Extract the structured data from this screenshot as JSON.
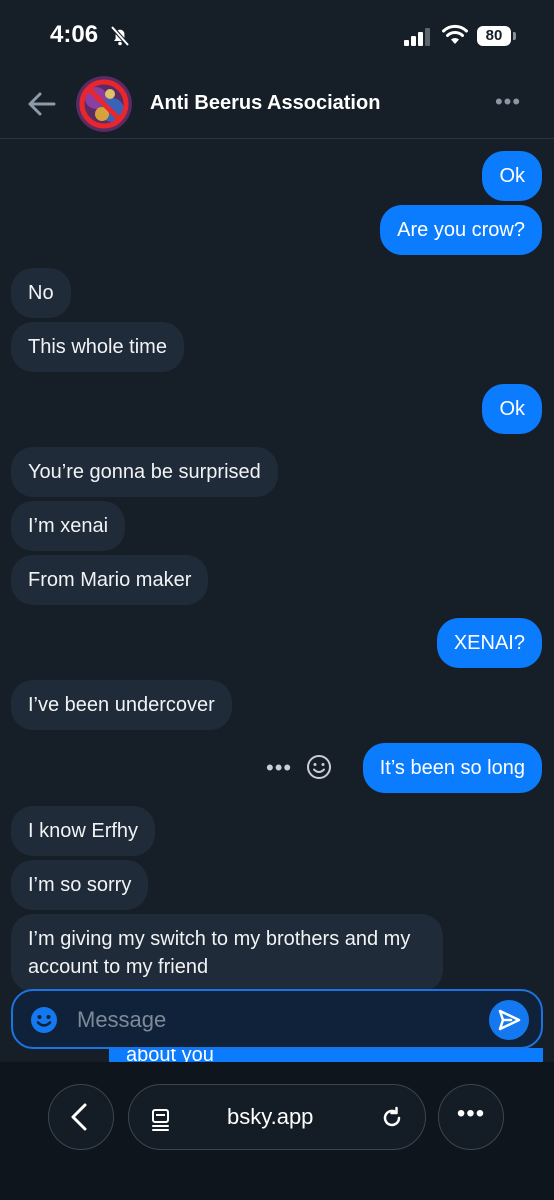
{
  "status_bar": {
    "time": "4:06",
    "battery": "80",
    "icons": [
      "bell-muted-icon",
      "signal-icon",
      "wifi-icon",
      "battery-icon"
    ]
  },
  "header": {
    "title": "Anti Beerus Association",
    "back_icon": "arrow-left-icon",
    "more_icon": "ellipsis-icon",
    "more_label": "•••"
  },
  "messages": [
    {
      "from": "me",
      "text": "Ok"
    },
    {
      "from": "me",
      "text": "Are you crow?"
    },
    {
      "from": "them",
      "text": "No"
    },
    {
      "from": "them",
      "text": "This whole time"
    },
    {
      "from": "me",
      "text": "Ok"
    },
    {
      "from": "them",
      "text": "You’re gonna be surprised"
    },
    {
      "from": "them",
      "text": "I’m xenai"
    },
    {
      "from": "them",
      "text": "From Mario maker"
    },
    {
      "from": "me",
      "text": "XENAI?"
    },
    {
      "from": "them",
      "text": "I’ve been undercover"
    },
    {
      "from": "me",
      "text": "It’s been so long"
    },
    {
      "from": "them",
      "text": "I know Erfhy"
    },
    {
      "from": "them",
      "text": "I’m so sorry"
    },
    {
      "from": "them",
      "text": "I’m giving my switch to my brothers and my account to my friend"
    },
    {
      "from": "me",
      "text": "about you"
    }
  ],
  "message_actions": {
    "dots": "•••",
    "icons": [
      "ellipsis-icon",
      "emoji-icon"
    ]
  },
  "composer": {
    "placeholder": "Message",
    "icons": [
      "emoji-icon",
      "send-icon"
    ]
  },
  "browser": {
    "url": "bsky.app",
    "menu_label": "•••",
    "icons": [
      "chevron-left-icon",
      "reader-icon",
      "reload-icon",
      "ellipsis-icon"
    ]
  },
  "colors": {
    "background": "#161e27",
    "incoming_bubble": "#1f2b38",
    "outgoing_bubble": "#0c7cff",
    "accent": "#1479f0"
  }
}
